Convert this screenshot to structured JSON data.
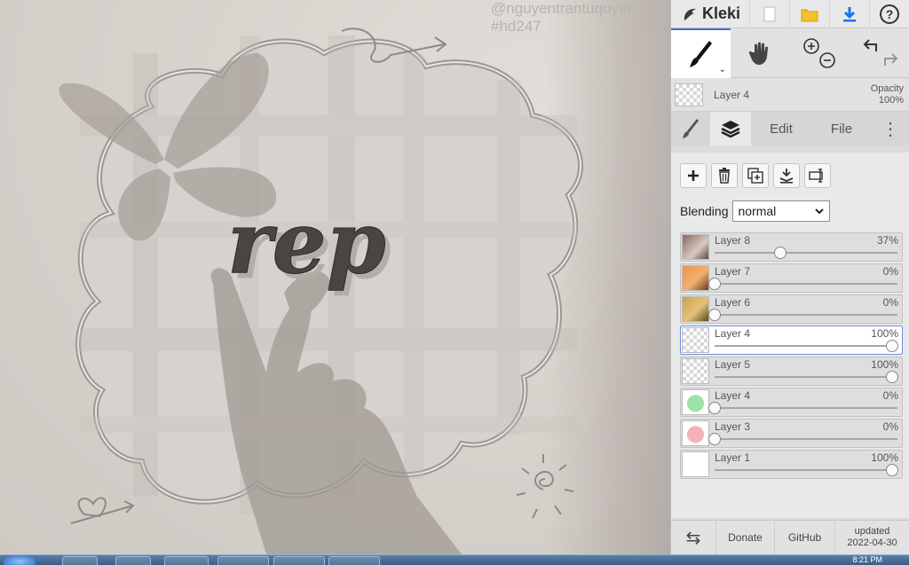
{
  "canvas": {
    "watermark_line1": "@nguyentrantuquyen",
    "watermark_line2": "#hd247",
    "artwork_text": "rep"
  },
  "topbar": {
    "app_name": "Kleki",
    "icons": [
      "kleki-logo-icon",
      "new-document-icon",
      "open-folder-icon",
      "download-icon",
      "help-icon"
    ],
    "help_symbol": "?"
  },
  "tools": {
    "brush_caret": "⌄",
    "items": [
      "brush-icon",
      "hand-icon",
      "zoom-in-out-icon",
      "undo-redo-icon"
    ]
  },
  "current_layer": {
    "name": "Layer 4",
    "opacity_label": "Opacity",
    "opacity_value": "100%"
  },
  "tabs": {
    "edit": "Edit",
    "file": "File",
    "more": "⋮"
  },
  "layer_actions": [
    "add-layer-icon",
    "delete-layer-icon",
    "duplicate-layer-icon",
    "merge-down-icon",
    "rename-layer-icon"
  ],
  "blending": {
    "label": "Blending",
    "value": "normal"
  },
  "layers": [
    {
      "name": "Layer 8",
      "opacity": "37%",
      "level": 0.37,
      "thumb": "photo"
    },
    {
      "name": "Layer 7",
      "opacity": "0%",
      "level": 0.0,
      "thumb": "orange"
    },
    {
      "name": "Layer 6",
      "opacity": "0%",
      "level": 0.0,
      "thumb": "gold"
    },
    {
      "name": "Layer 4",
      "opacity": "100%",
      "level": 1.0,
      "thumb": "checker",
      "active": true
    },
    {
      "name": "Layer 5",
      "opacity": "100%",
      "level": 1.0,
      "thumb": "checker"
    },
    {
      "name": "Layer 4",
      "opacity": "0%",
      "level": 0.0,
      "thumb": "green"
    },
    {
      "name": "Layer 3",
      "opacity": "0%",
      "level": 0.0,
      "thumb": "pink"
    },
    {
      "name": "Layer 1",
      "opacity": "100%",
      "level": 1.0,
      "thumb": "white"
    }
  ],
  "bottombar": {
    "swap_symbol": "⇆",
    "donate": "Donate",
    "github": "GitHub",
    "updated_label": "updated",
    "updated_date": "2022-04-30"
  },
  "taskbar": {
    "clock": "8:21 PM"
  },
  "colors": {
    "accent": "#3d6fd6",
    "download_blue": "#1a73e8",
    "folder_yellow": "#f2c12e"
  }
}
